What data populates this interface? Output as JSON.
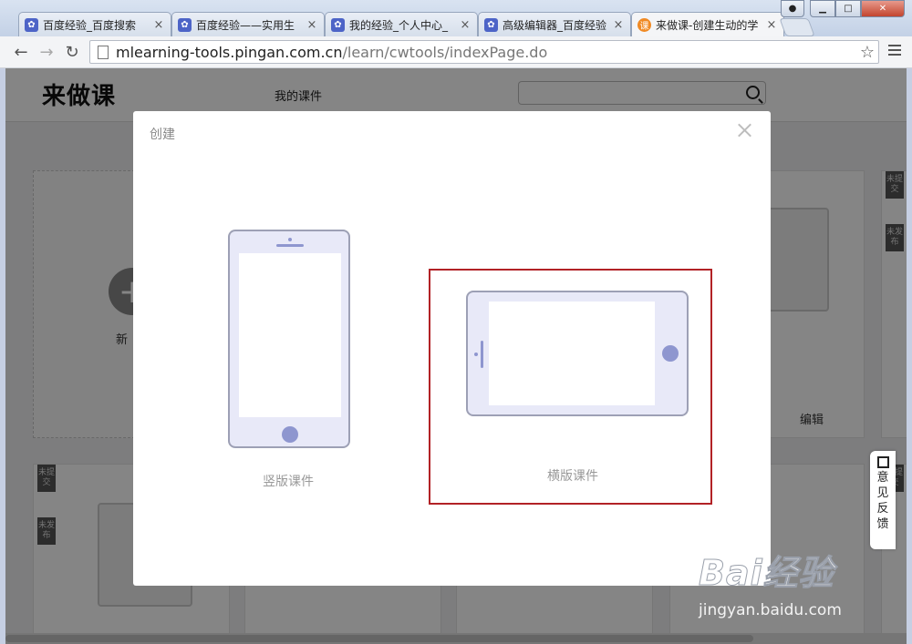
{
  "browser": {
    "tabs": [
      {
        "label": "百度经验_百度搜索",
        "active": false
      },
      {
        "label": "百度经验——实用生",
        "active": false
      },
      {
        "label": "我的经验_个人中心_",
        "active": false
      },
      {
        "label": "高级编辑器_百度经验",
        "active": false
      },
      {
        "label": "来做课-创建生动的学",
        "active": true
      }
    ],
    "tab_close_glyph": "×",
    "favicon_active_glyph": "课",
    "url_host": "mlearning-tools.pingan.com.cn",
    "url_path": "/learn/cwtools/indexPage.do"
  },
  "site": {
    "logo": "来做课",
    "nav_my_courses": "我的课件",
    "new_label": "新",
    "edit_label": "编辑",
    "ribbon_unsubmitted": "未提交",
    "ribbon_unpublished": "未发布"
  },
  "dialog": {
    "title": "创建",
    "portrait_label": "竖版课件",
    "landscape_label": "横版课件"
  },
  "feedback": {
    "label": "意见反馈"
  },
  "watermark": {
    "brand": "Bai经验",
    "url": "jingyan.baidu.com"
  },
  "colors": {
    "device_fill": "#e8e9f8",
    "device_accent": "#8e96cf",
    "highlight_border": "#b22226"
  }
}
